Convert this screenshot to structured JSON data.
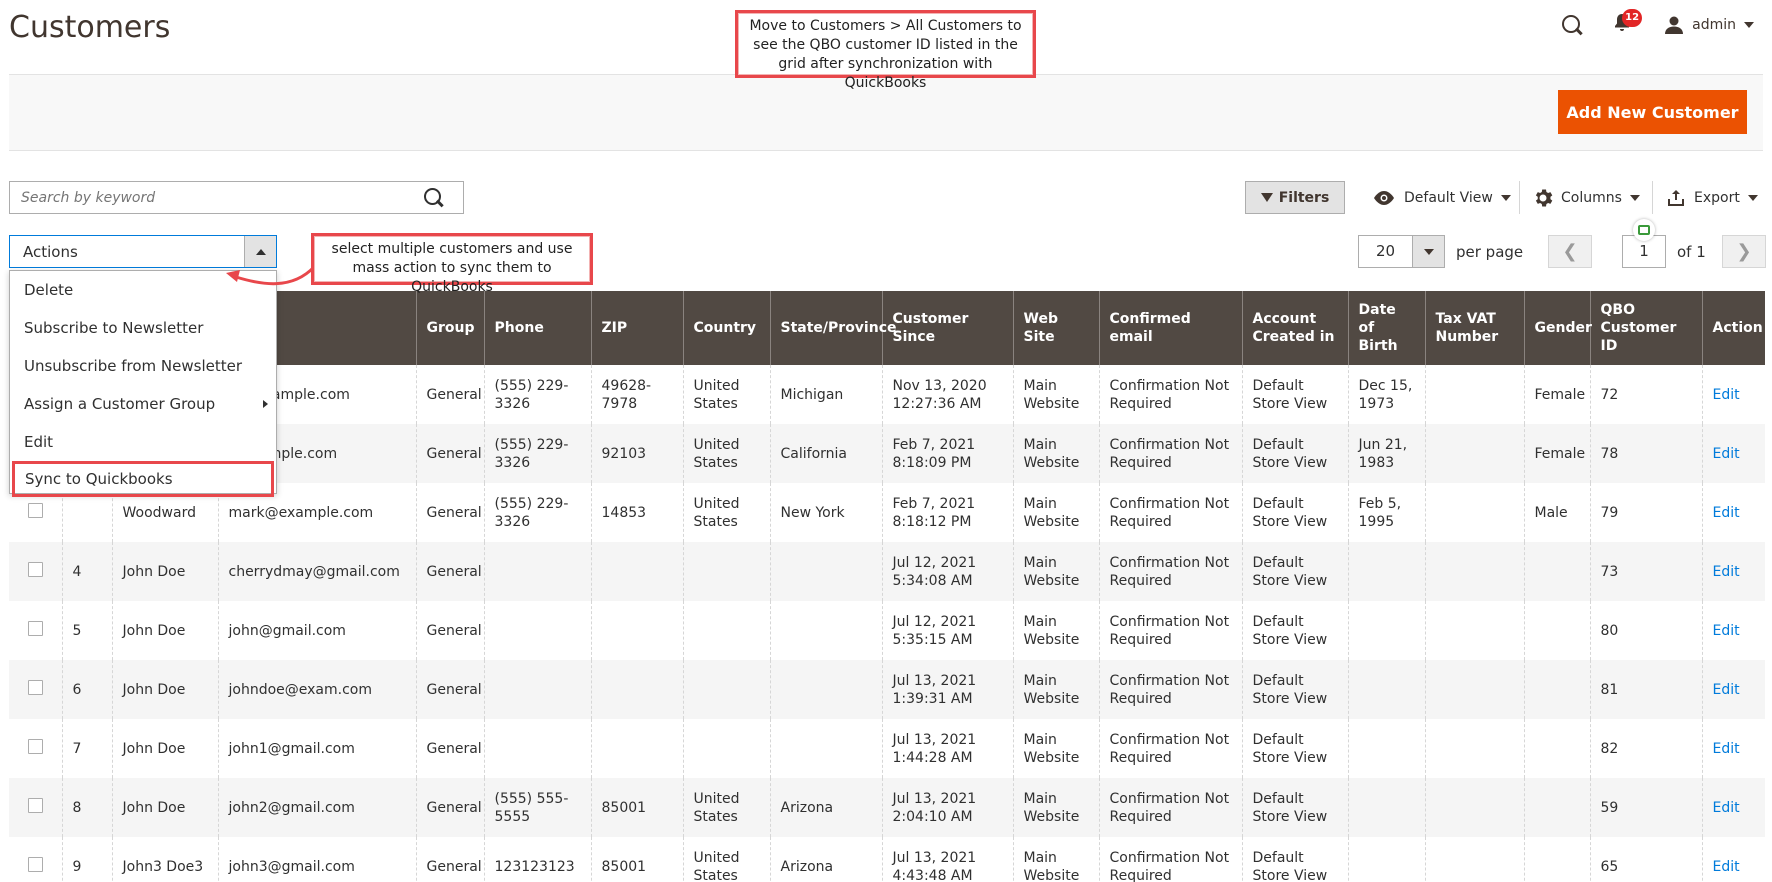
{
  "header": {
    "title": "Customers",
    "notifications_count": "12",
    "user_name": "admin"
  },
  "callouts": {
    "top": "Move to Customers > All Customers to see the QBO customer ID listed in the grid after synchronization with QuickBooks",
    "mass_action": "select multiple customers and use mass action to sync them to QuickBooks"
  },
  "toolbar": {
    "add_button": "Add New Customer",
    "search_placeholder": "Search by keyword",
    "filters_label": "Filters",
    "view_label": "Default View",
    "columns_label": "Columns",
    "export_label": "Export"
  },
  "actions": {
    "label": "Actions",
    "items": [
      "Delete",
      "Subscribe to Newsletter",
      "Unsubscribe from Newsletter",
      "Assign a Customer Group",
      "Edit",
      "Sync to Quickbooks"
    ]
  },
  "pager": {
    "per_page": "20",
    "per_page_label": "per page",
    "current_page": "1",
    "total_label": "of 1"
  },
  "grid": {
    "columns": [
      "",
      "",
      "",
      "",
      "Group",
      "Phone",
      "ZIP",
      "Country",
      "State/Province",
      "Customer Since",
      "Web Site",
      "Confirmed email",
      "Account Created in",
      "Date of Birth",
      "Tax VAT Number",
      "Gender",
      "QBO Customer ID",
      "Action"
    ],
    "rows": [
      {
        "id": "",
        "name": "",
        "email": "st@example.com",
        "group": "General",
        "phone": "(555) 229-3326",
        "zip": "49628-7978",
        "country": "United States",
        "state": "Michigan",
        "since": "Nov 13, 2020 12:27:36 AM",
        "website": "Main Website",
        "confirmed": "Confirmation Not Required",
        "created_in": "Default Store View",
        "dob": "Dec 15, 1973",
        "taxvat": "",
        "gender": "Female",
        "qbo": "72",
        "action": "Edit"
      },
      {
        "id": "",
        "name": "",
        "email": "@example.com",
        "group": "General",
        "phone": "(555) 229-3326",
        "zip": "92103",
        "country": "United States",
        "state": "California",
        "since": "Feb 7, 2021 8:18:09 PM",
        "website": "Main Website",
        "confirmed": "Confirmation Not Required",
        "created_in": "Default Store View",
        "dob": "Jun 21, 1983",
        "taxvat": "",
        "gender": "Female",
        "qbo": "78",
        "action": "Edit"
      },
      {
        "id": "",
        "name": "Woodward",
        "email": "mark@example.com",
        "group": "General",
        "phone": "(555) 229-3326",
        "zip": "14853",
        "country": "United States",
        "state": "New York",
        "since": "Feb 7, 2021 8:18:12 PM",
        "website": "Main Website",
        "confirmed": "Confirmation Not Required",
        "created_in": "Default Store View",
        "dob": "Feb 5, 1995",
        "taxvat": "",
        "gender": "Male",
        "qbo": "79",
        "action": "Edit"
      },
      {
        "id": "4",
        "name": "John Doe",
        "email": "cherrydmay@gmail.com",
        "group": "General",
        "phone": "",
        "zip": "",
        "country": "",
        "state": "",
        "since": "Jul 12, 2021 5:34:08 AM",
        "website": "Main Website",
        "confirmed": "Confirmation Not Required",
        "created_in": "Default Store View",
        "dob": "",
        "taxvat": "",
        "gender": "",
        "qbo": "73",
        "action": "Edit"
      },
      {
        "id": "5",
        "name": "John Doe",
        "email": "john@gmail.com",
        "group": "General",
        "phone": "",
        "zip": "",
        "country": "",
        "state": "",
        "since": "Jul 12, 2021 5:35:15 AM",
        "website": "Main Website",
        "confirmed": "Confirmation Not Required",
        "created_in": "Default Store View",
        "dob": "",
        "taxvat": "",
        "gender": "",
        "qbo": "80",
        "action": "Edit"
      },
      {
        "id": "6",
        "name": "John Doe",
        "email": "johndoe@exam.com",
        "group": "General",
        "phone": "",
        "zip": "",
        "country": "",
        "state": "",
        "since": "Jul 13, 2021 1:39:31 AM",
        "website": "Main Website",
        "confirmed": "Confirmation Not Required",
        "created_in": "Default Store View",
        "dob": "",
        "taxvat": "",
        "gender": "",
        "qbo": "81",
        "action": "Edit"
      },
      {
        "id": "7",
        "name": "John Doe",
        "email": "john1@gmail.com",
        "group": "General",
        "phone": "",
        "zip": "",
        "country": "",
        "state": "",
        "since": "Jul 13, 2021 1:44:28 AM",
        "website": "Main Website",
        "confirmed": "Confirmation Not Required",
        "created_in": "Default Store View",
        "dob": "",
        "taxvat": "",
        "gender": "",
        "qbo": "82",
        "action": "Edit"
      },
      {
        "id": "8",
        "name": "John Doe",
        "email": "john2@gmail.com",
        "group": "General",
        "phone": "(555) 555-5555",
        "zip": "85001",
        "country": "United States",
        "state": "Arizona",
        "since": "Jul 13, 2021 2:04:10 AM",
        "website": "Main Website",
        "confirmed": "Confirmation Not Required",
        "created_in": "Default Store View",
        "dob": "",
        "taxvat": "",
        "gender": "",
        "qbo": "59",
        "action": "Edit"
      },
      {
        "id": "9",
        "name": "John3 Doe3",
        "email": "john3@gmail.com",
        "group": "General",
        "phone": "123123123",
        "zip": "85001",
        "country": "United States",
        "state": "Arizona",
        "since": "Jul 13, 2021 4:43:48 AM",
        "website": "Main Website",
        "confirmed": "Confirmation Not Required",
        "created_in": "Default Store View",
        "dob": "",
        "taxvat": "",
        "gender": "",
        "qbo": "65",
        "action": "Edit"
      }
    ]
  },
  "colors": {
    "accent": "#eb5202",
    "grid_header": "#514943",
    "callout_border": "#e8474b",
    "link": "#007bdb"
  }
}
